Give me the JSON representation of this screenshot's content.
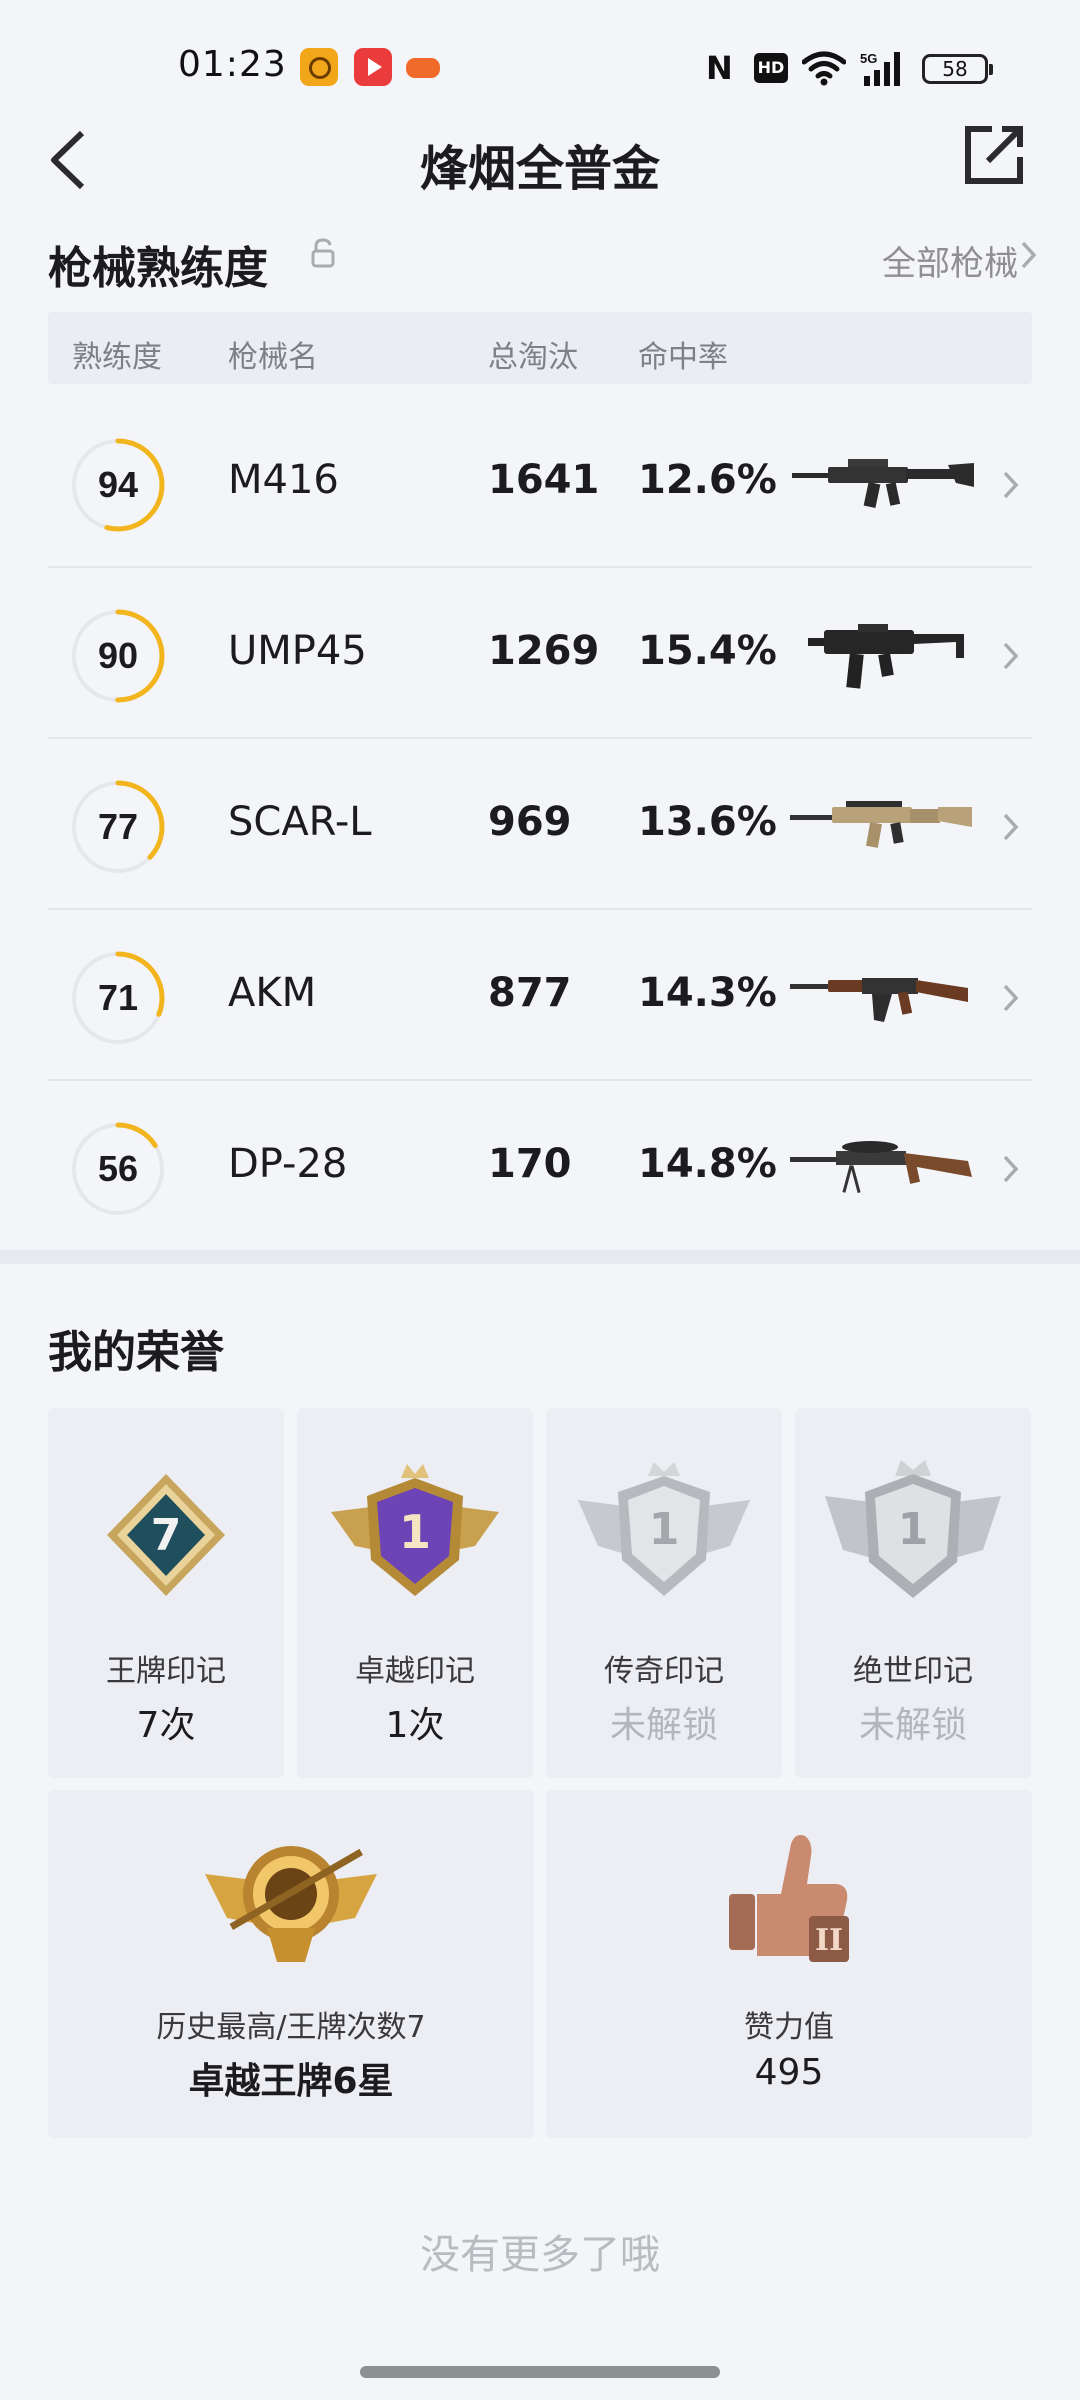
{
  "status_bar": {
    "time": "01:23",
    "battery": "58"
  },
  "header": {
    "title": "烽烟全普金"
  },
  "mastery": {
    "title": "枪械熟练度",
    "all_link": "全部枪械",
    "columns": [
      "熟练度",
      "枪械名",
      "总淘汰",
      "命中率"
    ],
    "rows": [
      {
        "level": 94,
        "name": "M416",
        "kills": "1641",
        "hit_rate": "12.6%",
        "icon": "m416-rifle-icon"
      },
      {
        "level": 90,
        "name": "UMP45",
        "kills": "1269",
        "hit_rate": "15.4%",
        "icon": "ump45-smg-icon"
      },
      {
        "level": 77,
        "name": "SCAR-L",
        "kills": "969",
        "hit_rate": "13.6%",
        "icon": "scar-l-rifle-icon"
      },
      {
        "level": 71,
        "name": "AKM",
        "kills": "877",
        "hit_rate": "14.3%",
        "icon": "akm-rifle-icon"
      },
      {
        "level": 56,
        "name": "DP-28",
        "kills": "170",
        "hit_rate": "14.8%",
        "icon": "dp28-lmg-icon"
      }
    ]
  },
  "honors": {
    "title": "我的荣誉",
    "badges": [
      {
        "label": "王牌印记",
        "value": "7次",
        "locked": false,
        "badge_text": "7",
        "icon": "ace-mark-badge-icon"
      },
      {
        "label": "卓越印记",
        "value": "1次",
        "locked": false,
        "badge_text": "1",
        "icon": "excellence-mark-badge-icon"
      },
      {
        "label": "传奇印记",
        "value": "未解锁",
        "locked": true,
        "badge_text": "1",
        "icon": "legend-mark-badge-icon"
      },
      {
        "label": "绝世印记",
        "value": "未解锁",
        "locked": true,
        "badge_text": "1",
        "icon": "peerless-mark-badge-icon"
      }
    ],
    "history": {
      "label": "历史最高/王牌次数7",
      "value": "卓越王牌6星",
      "icon": "ace-rank-emblem-icon"
    },
    "likes": {
      "label": "赞力值",
      "value": "495",
      "icon": "thumbs-up-trophy-icon"
    }
  },
  "footer": {
    "text": "没有更多了哦"
  },
  "colors": {
    "ring_accent": "#f2b51e",
    "ring_track": "#e6e7ea",
    "background": "#f3f5f9",
    "card": "#eceef3"
  }
}
